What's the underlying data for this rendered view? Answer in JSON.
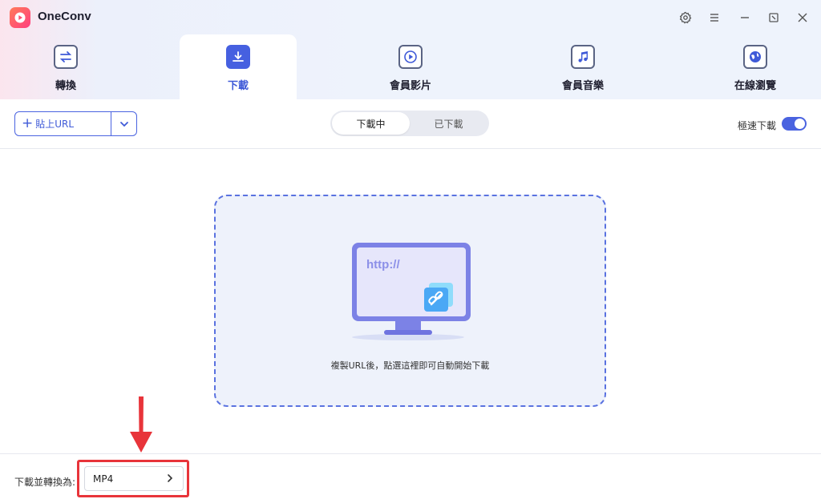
{
  "app": {
    "title": "OneConv"
  },
  "nav": {
    "tabs": [
      {
        "label": "轉換"
      },
      {
        "label": "下載"
      },
      {
        "label": "會員影片"
      },
      {
        "label": "會員音樂"
      },
      {
        "label": "在線瀏覽"
      }
    ],
    "active_tab": "下載"
  },
  "toolbar": {
    "paste_label": "貼上URL",
    "segments": [
      "下載中",
      "已下載"
    ],
    "active_segment": "下載中",
    "turbo_label": "極速下載",
    "turbo_on": true
  },
  "dropzone": {
    "illustration_text": "http://",
    "hint": "複製URL後，點選這裡即可自動開始下載"
  },
  "footer": {
    "convert_label": "下載並轉換為:",
    "format_value": "MP4"
  },
  "colors": {
    "accent": "#4a63e0",
    "highlight": "#e8343a"
  }
}
